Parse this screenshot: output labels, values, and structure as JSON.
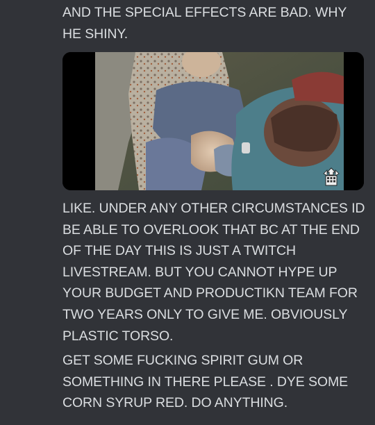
{
  "message": {
    "paragraph_top": "AND THE SPECIAL EFFECTS ARE BAD. WHY HE SHINY.",
    "image_attachment": {
      "alt": "",
      "watermark_icon": "watermark-logo-icon"
    },
    "paragraph_mid": "LIKE. UNDER ANY OTHER CIRCUMSTANCES ID BE ABLE TO OVERLOOK THAT BC AT THE END OF THE DAY THIS IS JUST A TWITCH LIVESTREAM. BUT YOU CANNOT HYPE UP YOUR BUDGET AND PRODUCTIKN TEAM FOR TWO YEARS ONLY TO GIVE ME. OBVIOUSLY PLASTIC TORSO.",
    "paragraph_bottom": "GET SOME FUCKING SPIRIT GUM OR SOMETHING IN THERE PLEASE . DYE SOME CORN SYRUP RED. DO ANYTHING."
  },
  "colors": {
    "background": "#313338",
    "text": "#dbdee1"
  }
}
